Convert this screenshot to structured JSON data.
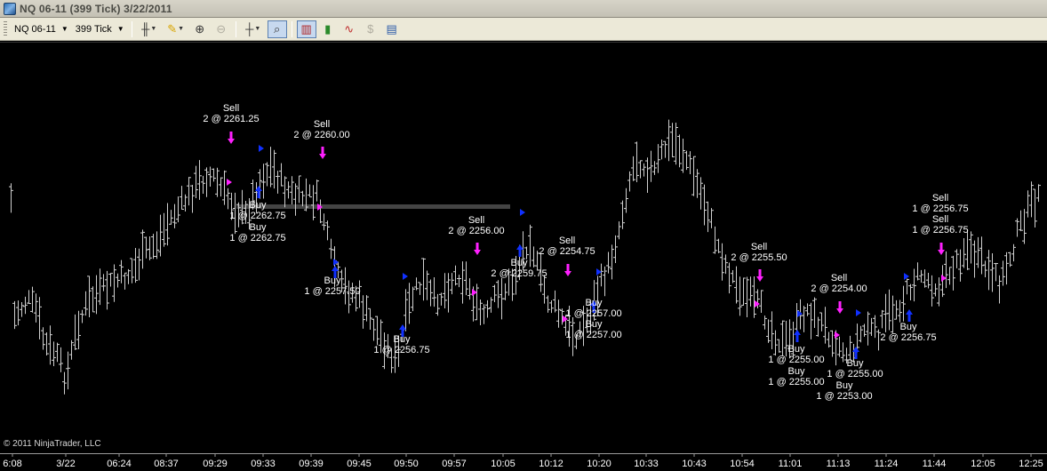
{
  "window": {
    "title": "NQ 06-11 (399 Tick)  3/22/2011"
  },
  "toolbar": {
    "instrument": "NQ 06-11",
    "period": "399 Tick",
    "buttons": [
      {
        "name": "bar-type-icon",
        "symbol": "╫"
      },
      {
        "name": "drawing-pencil-icon",
        "symbol": "✎"
      },
      {
        "name": "zoom-in-icon",
        "symbol": "⊕"
      },
      {
        "name": "zoom-out-icon",
        "symbol": "⊖"
      },
      {
        "name": "crosshair-icon",
        "symbol": "┼"
      },
      {
        "name": "magnifier-icon",
        "symbol": "⌕"
      },
      {
        "name": "chart-style-icon",
        "symbol": "▥"
      },
      {
        "name": "candlestick-icon",
        "symbol": "▮"
      },
      {
        "name": "indicator-icon",
        "symbol": "∿"
      },
      {
        "name": "strategy-icon",
        "symbol": "$"
      },
      {
        "name": "properties-icon",
        "symbol": "▤"
      }
    ]
  },
  "chart": {
    "copyright": "© 2011 NinjaTrader, LLC",
    "colors": {
      "background": "#000000",
      "bar": "#d0d0d0",
      "buy_arrow": "#1030ff",
      "sell_arrow": "#ff20ff",
      "label": "#ffffff",
      "level_line": "#444444"
    },
    "time_labels": [
      "6:08",
      "3/22",
      "06:24",
      "08:37",
      "09:29",
      "09:33",
      "09:39",
      "09:45",
      "09:50",
      "09:57",
      "10:05",
      "10:12",
      "10:20",
      "10:33",
      "10:43",
      "10:54",
      "11:01",
      "11:13",
      "11:24",
      "11:44",
      "12:05",
      "12:25"
    ],
    "executions": [
      {
        "id": "e1",
        "side": "Sell",
        "text1": "Sell",
        "text2": "2 @ 2261.25"
      },
      {
        "id": "e2",
        "side": "Sell",
        "text1": "Sell",
        "text2": "2 @ 2260.00"
      },
      {
        "id": "e3",
        "side": "Buy",
        "text1": "Buy",
        "text2": "1 @ 2262.75"
      },
      {
        "id": "e4",
        "side": "Buy",
        "text1": "Buy",
        "text2": "1 @ 2262.75"
      },
      {
        "id": "e5",
        "side": "Buy",
        "text1": "Buy",
        "text2": "1 @ 2257.50"
      },
      {
        "id": "e6",
        "side": "Buy",
        "text1": "Buy",
        "text2": "1 @ 2256.75"
      },
      {
        "id": "e7",
        "side": "Sell",
        "text1": "Sell",
        "text2": "2 @ 2256.00"
      },
      {
        "id": "e8",
        "side": "Buy",
        "text1": "Buy",
        "text2": "2 @ 2259.75"
      },
      {
        "id": "e9",
        "side": "Sell",
        "text1": "Sell",
        "text2": "2 @ 2254.75"
      },
      {
        "id": "e10",
        "side": "Buy",
        "text1": "Buy",
        "text2": "1 @ 2257.00"
      },
      {
        "id": "e11",
        "side": "Buy",
        "text1": "Buy",
        "text2": "1 @ 2257.00"
      },
      {
        "id": "e12",
        "side": "Sell",
        "text1": "Sell",
        "text2": "2 @ 2255.50"
      },
      {
        "id": "e13",
        "side": "Buy",
        "text1": "Buy",
        "text2": "1 @ 2255.00"
      },
      {
        "id": "e14",
        "side": "Buy",
        "text1": "Buy",
        "text2": "1 @ 2255.00"
      },
      {
        "id": "e15",
        "side": "Sell",
        "text1": "Sell",
        "text2": "2 @ 2254.00"
      },
      {
        "id": "e16",
        "side": "Buy",
        "text1": "Buy",
        "text2": "1 @ 2255.00"
      },
      {
        "id": "e17",
        "side": "Buy",
        "text1": "Buy",
        "text2": "1 @ 2253.00"
      },
      {
        "id": "e18",
        "side": "Buy",
        "text1": "Buy",
        "text2": "2 @ 2256.75"
      },
      {
        "id": "e19",
        "side": "Sell",
        "text1": "Sell",
        "text2": "1 @ 2256.75"
      },
      {
        "id": "e20",
        "side": "Sell",
        "text1": "Sell",
        "text2": "1 @ 2256.75"
      }
    ]
  }
}
